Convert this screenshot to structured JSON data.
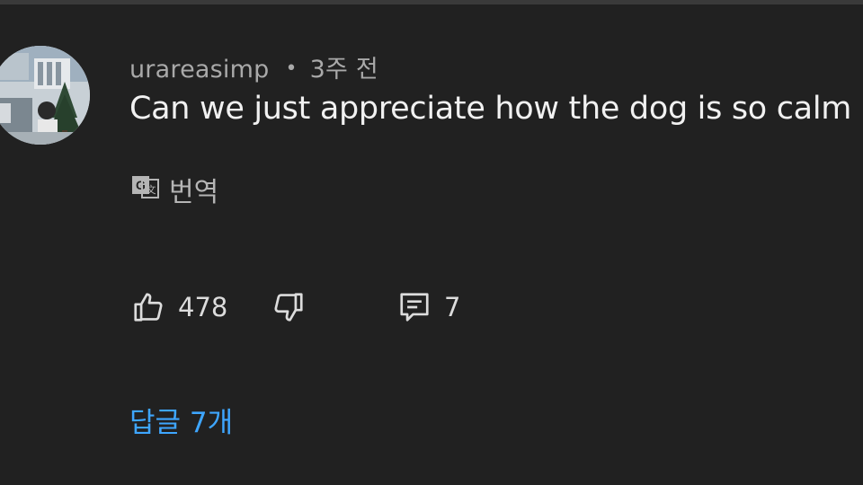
{
  "comment": {
    "username": "urareasimp",
    "separator": "•",
    "timestamp": "3주 전",
    "text": "Can we just appreciate how the dog is so calm",
    "translate_label": "번역",
    "likes": "478",
    "replies_count": "7",
    "replies_link": "답글 7개"
  },
  "icons": {
    "translate": "translate-icon",
    "like": "thumbs-up-icon",
    "dislike": "thumbs-down-icon",
    "reply": "reply-comment-icon"
  },
  "colors": {
    "background": "#212121",
    "text_primary": "#f1f1f1",
    "text_secondary": "#a9a9a9",
    "link": "#3ea6ff"
  }
}
